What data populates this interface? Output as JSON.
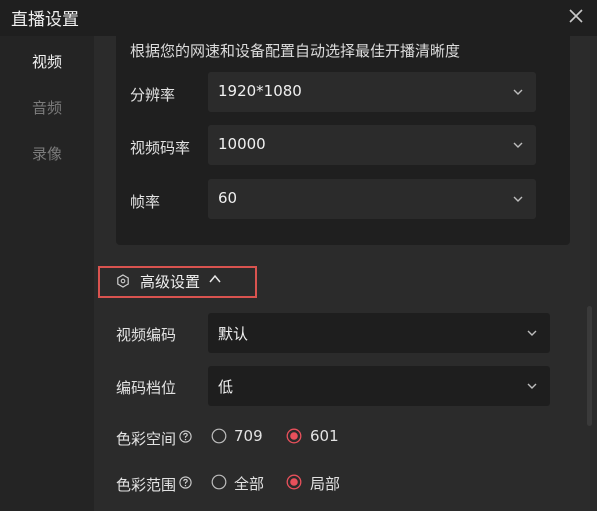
{
  "window": {
    "title": "直播设置"
  },
  "sidebar": {
    "items": [
      {
        "label": "视频",
        "active": true
      },
      {
        "label": "音频",
        "active": false
      },
      {
        "label": "录像",
        "active": false
      }
    ]
  },
  "auto": {
    "description": "根据您的网速和设备配置自动选择最佳开播清晰度",
    "resolution": {
      "label": "分辨率",
      "value": "1920*1080"
    },
    "bitrate": {
      "label": "视频码率",
      "value": "10000"
    },
    "fps": {
      "label": "帧率",
      "value": "60"
    }
  },
  "advanced": {
    "title": "高级设置",
    "video_codec": {
      "label": "视频编码",
      "value": "默认"
    },
    "encode_level": {
      "label": "编码档位",
      "value": "低"
    },
    "color_space": {
      "label": "色彩空间",
      "options": [
        "709",
        "601"
      ],
      "selected": "601"
    },
    "color_range": {
      "label": "色彩范围",
      "options": [
        "全部",
        "局部"
      ],
      "selected": "局部"
    }
  },
  "colors": {
    "accent": "#e8505b",
    "highlight_box": "#d9534f"
  },
  "icons": {
    "close": "close-icon",
    "chevron": "chevron-down-icon",
    "collapse": "chevron-up-icon",
    "settings": "hexagon-settings-icon",
    "help": "help-circle-icon"
  }
}
